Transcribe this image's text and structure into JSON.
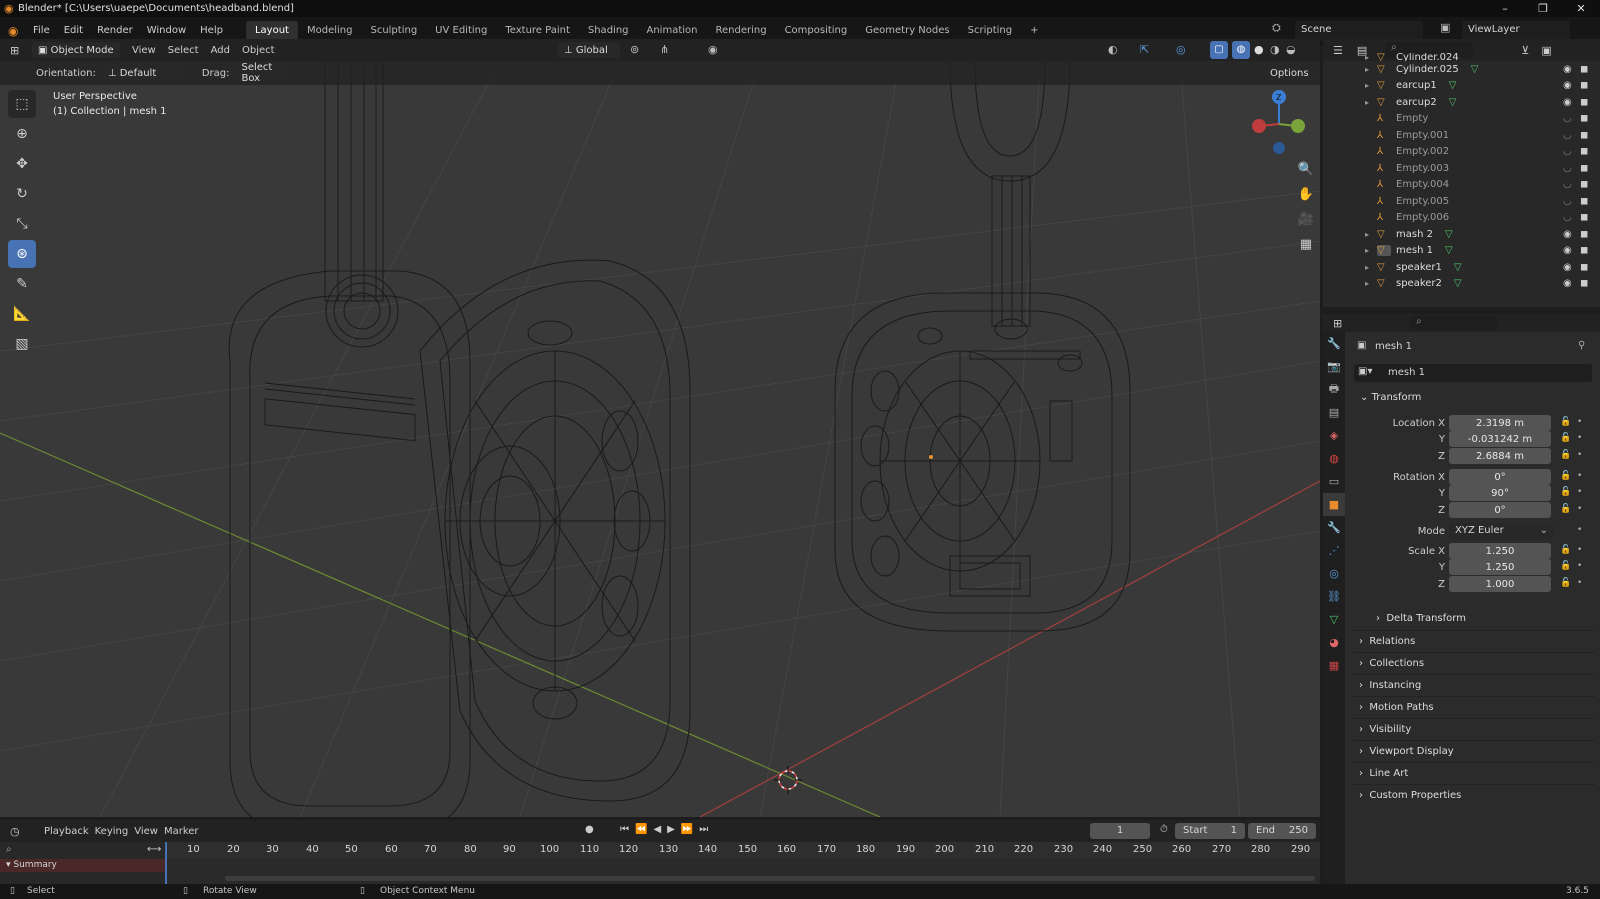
{
  "title_bar": {
    "title": "Blender* [C:\\Users\\uaepe\\Documents\\headband.blend]",
    "minimize": "–",
    "maximize": "❐",
    "close": "✕"
  },
  "menu": {
    "items": [
      "File",
      "Edit",
      "Render",
      "Window",
      "Help"
    ]
  },
  "workspaces": {
    "active": "Layout",
    "tabs": [
      "Layout",
      "Modeling",
      "Sculpting",
      "UV Editing",
      "Texture Paint",
      "Shading",
      "Animation",
      "Rendering",
      "Compositing",
      "Geometry Nodes",
      "Scripting"
    ],
    "add": "+"
  },
  "scene": {
    "scene_name": "Scene",
    "view_layer": "ViewLayer"
  },
  "viewport_header": {
    "mode": "Object Mode",
    "view": "View",
    "select": "Select",
    "add": "Add",
    "object": "Object",
    "transform_orientation": "Global",
    "orientation_label": "Orientation:",
    "orientation_value": "Default",
    "drag_label": "Drag:",
    "drag_value": "Select Box",
    "options": "Options"
  },
  "viewport_overlay": {
    "perspective": "User Perspective",
    "collection": "(1) Collection | mesh 1",
    "gizmo_x": "X",
    "gizmo_y": "Y",
    "gizmo_z": "Z"
  },
  "outliner": {
    "items": [
      {
        "name": "Cylinder.024",
        "type": "mesh",
        "expandable": true
      },
      {
        "name": "Cylinder.025",
        "type": "mesh",
        "expandable": true
      },
      {
        "name": "earcup1",
        "type": "mesh",
        "expandable": true
      },
      {
        "name": "earcup2",
        "type": "mesh",
        "expandable": true
      },
      {
        "name": "Empty",
        "type": "empty",
        "expandable": false
      },
      {
        "name": "Empty.001",
        "type": "empty",
        "expandable": false
      },
      {
        "name": "Empty.002",
        "type": "empty",
        "expandable": false
      },
      {
        "name": "Empty.003",
        "type": "empty",
        "expandable": false
      },
      {
        "name": "Empty.004",
        "type": "empty",
        "expandable": false
      },
      {
        "name": "Empty.005",
        "type": "empty",
        "expandable": false
      },
      {
        "name": "Empty.006",
        "type": "empty",
        "expandable": false
      },
      {
        "name": "mash 2",
        "type": "mesh",
        "expandable": true
      },
      {
        "name": "mesh 1",
        "type": "mesh",
        "expandable": true
      },
      {
        "name": "speaker1",
        "type": "mesh",
        "expandable": true
      },
      {
        "name": "speaker2",
        "type": "mesh",
        "expandable": true
      }
    ]
  },
  "properties": {
    "object_name": "mesh 1",
    "datablock_name": "mesh 1",
    "transform_header": "Transform",
    "location_label": "Location X",
    "loc_x": "2.3198 m",
    "loc_y": "-0.031242 m",
    "loc_z": "2.6884 m",
    "rotation_label": "Rotation X",
    "rot_x": "0°",
    "rot_y": "90°",
    "rot_z": "0°",
    "mode_label": "Mode",
    "mode_value": "XYZ Euler",
    "scale_label": "Scale X",
    "scale_x": "1.250",
    "scale_y": "1.250",
    "scale_z": "1.000",
    "y_label": "Y",
    "z_label": "Z",
    "panels": [
      "Delta Transform",
      "Relations",
      "Collections",
      "Instancing",
      "Motion Paths",
      "Visibility",
      "Viewport Display",
      "Line Art",
      "Custom Properties"
    ]
  },
  "timeline": {
    "playback": "Playback",
    "keying": "Keying",
    "view": "View",
    "marker": "Marker",
    "current_frame": "1",
    "start_label": "Start",
    "start": "1",
    "end_label": "End",
    "end": "250",
    "ticks": [
      "10",
      "20",
      "30",
      "40",
      "50",
      "60",
      "70",
      "80",
      "90",
      "100",
      "110",
      "120",
      "130",
      "140",
      "150",
      "160",
      "170",
      "180",
      "190",
      "200",
      "210",
      "220",
      "230",
      "240",
      "250",
      "260",
      "270",
      "280",
      "290"
    ],
    "summary": "Summary"
  },
  "status_bar": {
    "select": "Select",
    "rotate": "Rotate View",
    "context": "Object Context Menu",
    "version": "3.6.5"
  },
  "colors": {
    "accent": "#4772b3",
    "x_axis": "#c13c3c",
    "y_axis": "#7aa33a",
    "z_axis": "#3b7ed6",
    "orange": "#e09a3d"
  }
}
